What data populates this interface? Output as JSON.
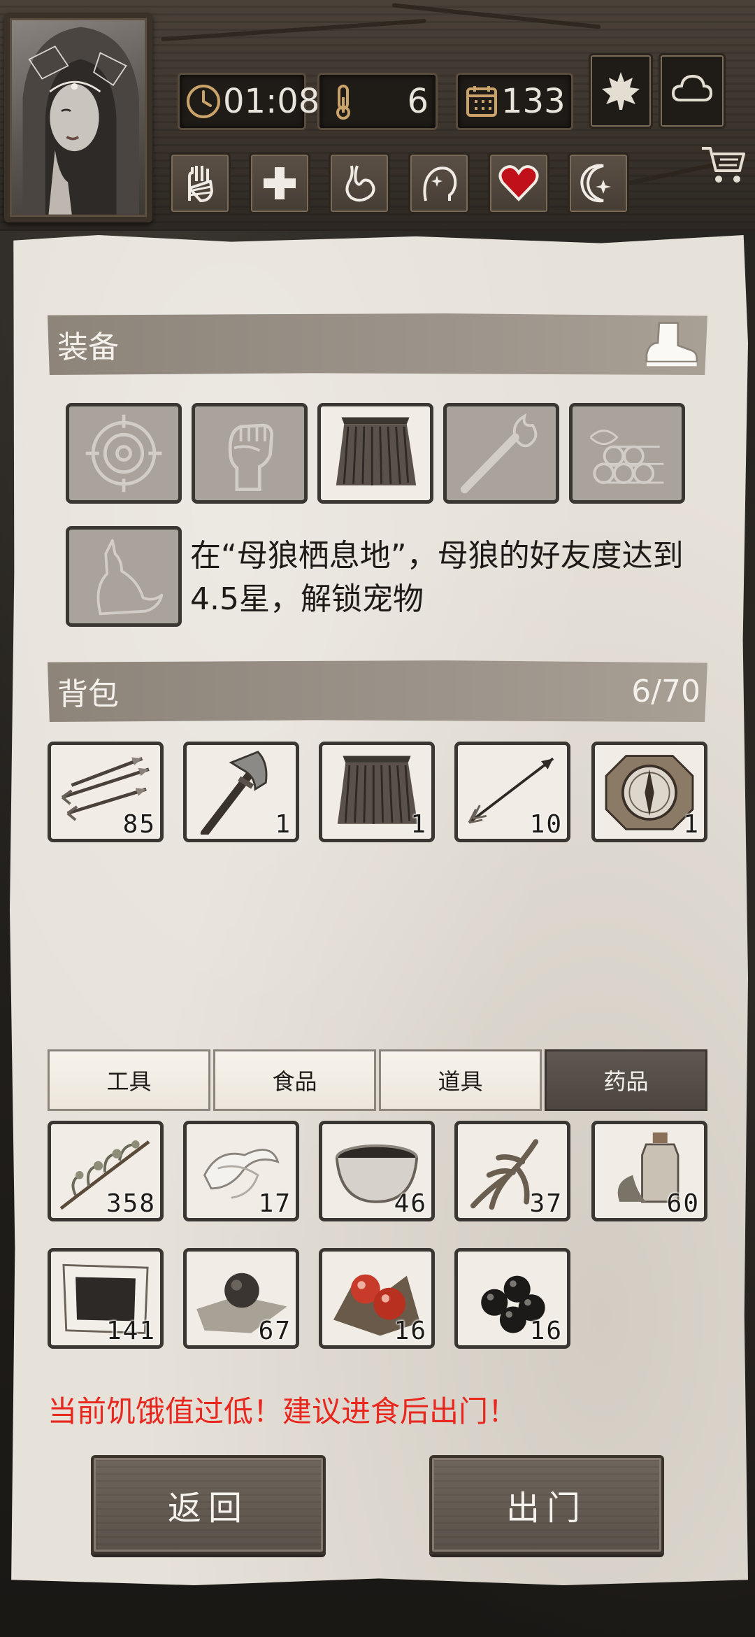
{
  "hud": {
    "time": "01:08",
    "temperature": "6",
    "day": "133",
    "season_icon": "maple-leaf-icon",
    "weather_icon": "cloud-icon"
  },
  "status_icons": [
    "hand-bandage-icon",
    "medical-cross-icon",
    "stomach-icon",
    "head-sparkle-icon",
    "heart-icon",
    "moon-star-icon"
  ],
  "status_heart_color": "#c0101a",
  "equipment": {
    "title": "装备",
    "slots": [
      {
        "icon": "target-icon",
        "empty": true
      },
      {
        "icon": "fist-icon",
        "empty": true
      },
      {
        "icon": "grass-skirt-icon",
        "empty": false
      },
      {
        "icon": "torch-icon",
        "empty": true
      },
      {
        "icon": "firewood-icon",
        "empty": true
      }
    ],
    "pet_slot_icon": "howling-wolf-icon",
    "pet_hint": "在“母狼栖息地”，母狼的好友度达到4.5星，解锁宠物"
  },
  "backpack": {
    "title": "背包",
    "capacity": "6/70",
    "items": [
      {
        "icon": "arrows-icon",
        "qty": "85"
      },
      {
        "icon": "stone-axe-icon",
        "qty": "1"
      },
      {
        "icon": "grass-skirt-icon",
        "qty": "1"
      },
      {
        "icon": "arrow-icon",
        "qty": "10"
      },
      {
        "icon": "compass-icon",
        "qty": "1"
      }
    ]
  },
  "tabs": [
    {
      "label": "工具",
      "active": false
    },
    {
      "label": "食品",
      "active": false
    },
    {
      "label": "道具",
      "active": false
    },
    {
      "label": "药品",
      "active": true
    }
  ],
  "storage": {
    "items": [
      {
        "icon": "herb-branch-icon",
        "qty": "358"
      },
      {
        "icon": "bandage-icon",
        "qty": "17"
      },
      {
        "icon": "bowl-icon",
        "qty": "46"
      },
      {
        "icon": "ginseng-icon",
        "qty": "37"
      },
      {
        "icon": "bottle-icon",
        "qty": "60"
      },
      {
        "icon": "herb-paste-icon",
        "qty": "141"
      },
      {
        "icon": "pill-icon",
        "qty": "67"
      },
      {
        "icon": "red-berries-icon",
        "qty": "16"
      },
      {
        "icon": "black-berries-icon",
        "qty": "16"
      }
    ]
  },
  "warning": "当前饥饿值过低！建议进食后出门！",
  "buttons": {
    "back": "返回",
    "go_out": "出门"
  },
  "colors": {
    "warning": "#e8281e",
    "active_tab": "#4c463f",
    "paper": "#e6e1d9"
  }
}
